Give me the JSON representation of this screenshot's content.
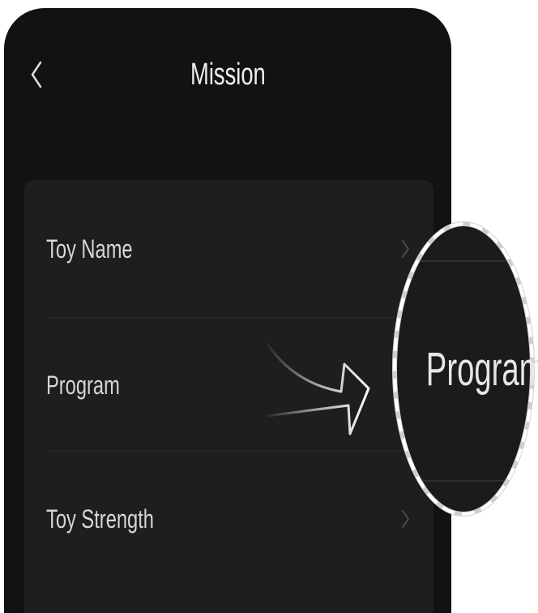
{
  "header": {
    "title": "Mission",
    "back_icon": "back-chevron-icon"
  },
  "list": {
    "items": [
      {
        "label": "Toy Name",
        "icon": "chevron-right-icon"
      },
      {
        "label": "Program",
        "icon": "chevron-right-icon"
      },
      {
        "label": "Toy Strength",
        "icon": "chevron-right-icon"
      }
    ]
  },
  "callout": {
    "label": "Program",
    "arrow_icon": "curved-arrow-icon"
  },
  "colors": {
    "screen_bg": "#121212",
    "panel_bg": "#1e1e1e",
    "text": "#d6d6d6",
    "chevron": "#4a4a4a",
    "magnifier_ring": "#cfcfcf",
    "magnifier_dash": "#ffffff"
  }
}
